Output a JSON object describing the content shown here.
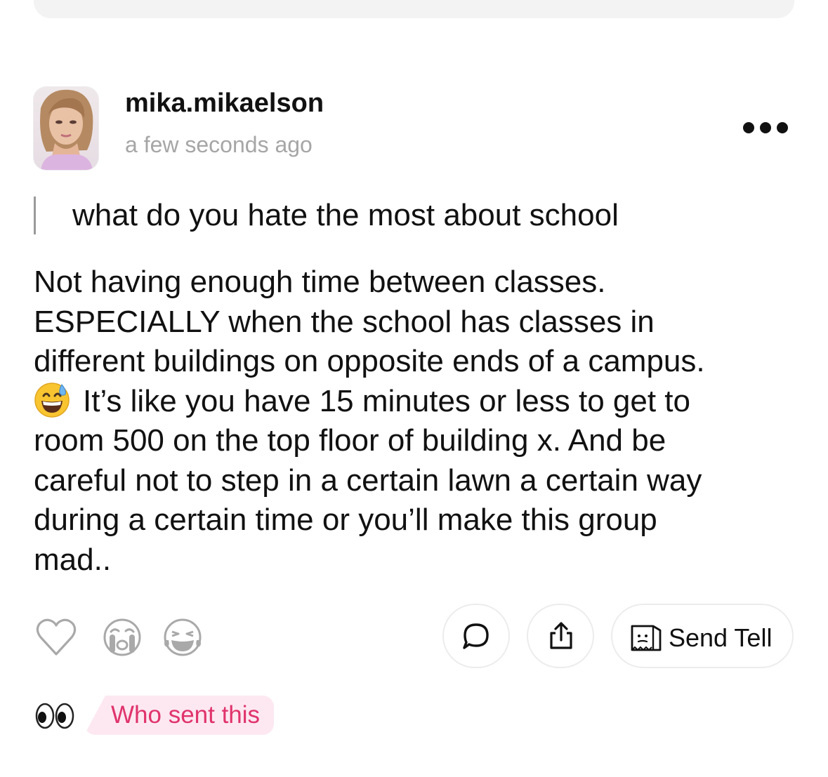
{
  "post": {
    "username": "mika.mikaelson",
    "timestamp": "a few seconds ago",
    "question": "what do you hate the most about school",
    "answer_lines": [
      "Not having enough time between classes.",
      "ESPECIALLY when the school has classes in",
      "different buildings on opposite ends of a campus.",
      "It’s like you have 15 minutes or less to get to",
      "room 500 on the top floor of building x. And be",
      "careful not to step in a certain lawn a certain way",
      "during a certain time or you’ll make this group",
      "mad.."
    ]
  },
  "actions": {
    "send_tell_label": "Send Tell",
    "who_sent_label": "Who sent this"
  },
  "icons": {
    "avatar": "profile-photo",
    "more": "more-horizontal-icon",
    "inline_emoji": "grinning-face-with-sweat-emoji",
    "reactions": [
      "heart-icon",
      "crying-face-icon",
      "laughing-face-icon"
    ],
    "comment": "speech-bubble-icon",
    "share": "share-upload-icon",
    "send_tell": "paper-bag-icon",
    "eyes": "eyes-emoji"
  },
  "colors": {
    "text": "#111111",
    "muted": "#a6a6a6",
    "accent_pink": "#e0336c",
    "pink_bg": "#fde8f1",
    "border": "#ececec"
  }
}
